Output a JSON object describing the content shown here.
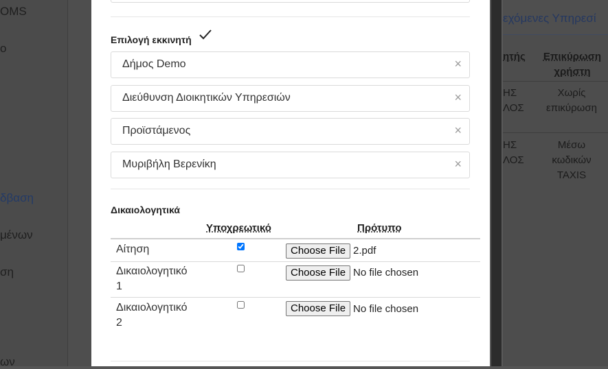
{
  "background": {
    "sidebar_items": [
      {
        "label": "OMS",
        "style": "dark"
      },
      {
        "label": "ο",
        "style": "dark"
      },
      {
        "label": "δβαση",
        "style": "blue"
      },
      {
        "label": "μένων",
        "style": "dark"
      },
      {
        "label": "ση",
        "style": "dark"
      },
      {
        "label": "ων",
        "style": "dark"
      }
    ],
    "right_panel": {
      "tab_title": "εχόμενες Υπηρεσί",
      "headers": [
        "ητής",
        "Επικύρωση χρήστη"
      ],
      "rows": [
        {
          "c1a": "ΗΣ",
          "c1b": "ΛΟΣ",
          "c2": [
            "Χωρίς",
            "επικύρωση"
          ]
        },
        {
          "c1a": "ΗΣ",
          "c1b": "ΛΟΣ",
          "c2": [
            "Μέσω",
            "κωδικών",
            "TAXIS"
          ]
        }
      ]
    }
  },
  "modal": {
    "initiator_section": {
      "title": "Επιλογή εκκινητή",
      "status_icon": "check-icon",
      "selections": [
        {
          "value": "Δήμος Demo",
          "clear": "×"
        },
        {
          "value": "Διεύθυνση Διοικητικών Υπηρεσιών",
          "clear": "×"
        },
        {
          "value": "Προϊστάμενος",
          "clear": "×"
        },
        {
          "value": "Μυριβήλη Βερενίκη",
          "clear": "×"
        }
      ]
    },
    "documents_section": {
      "title": "Δικαιολογητικά",
      "columns": {
        "mandatory": "Υποχρεωτικό",
        "template": "Πρότυπο"
      },
      "rows": [
        {
          "name_lines": [
            "Αίτηση"
          ],
          "mandatory": true,
          "button": "Choose File",
          "file": "2.pdf"
        },
        {
          "name_lines": [
            "Δικαιολογητικό",
            "1"
          ],
          "mandatory": false,
          "button": "Choose File",
          "file": "No file chosen"
        },
        {
          "name_lines": [
            "Δικαιολογητικό",
            "2"
          ],
          "mandatory": false,
          "button": "Choose File",
          "file": "No file chosen"
        }
      ]
    }
  }
}
